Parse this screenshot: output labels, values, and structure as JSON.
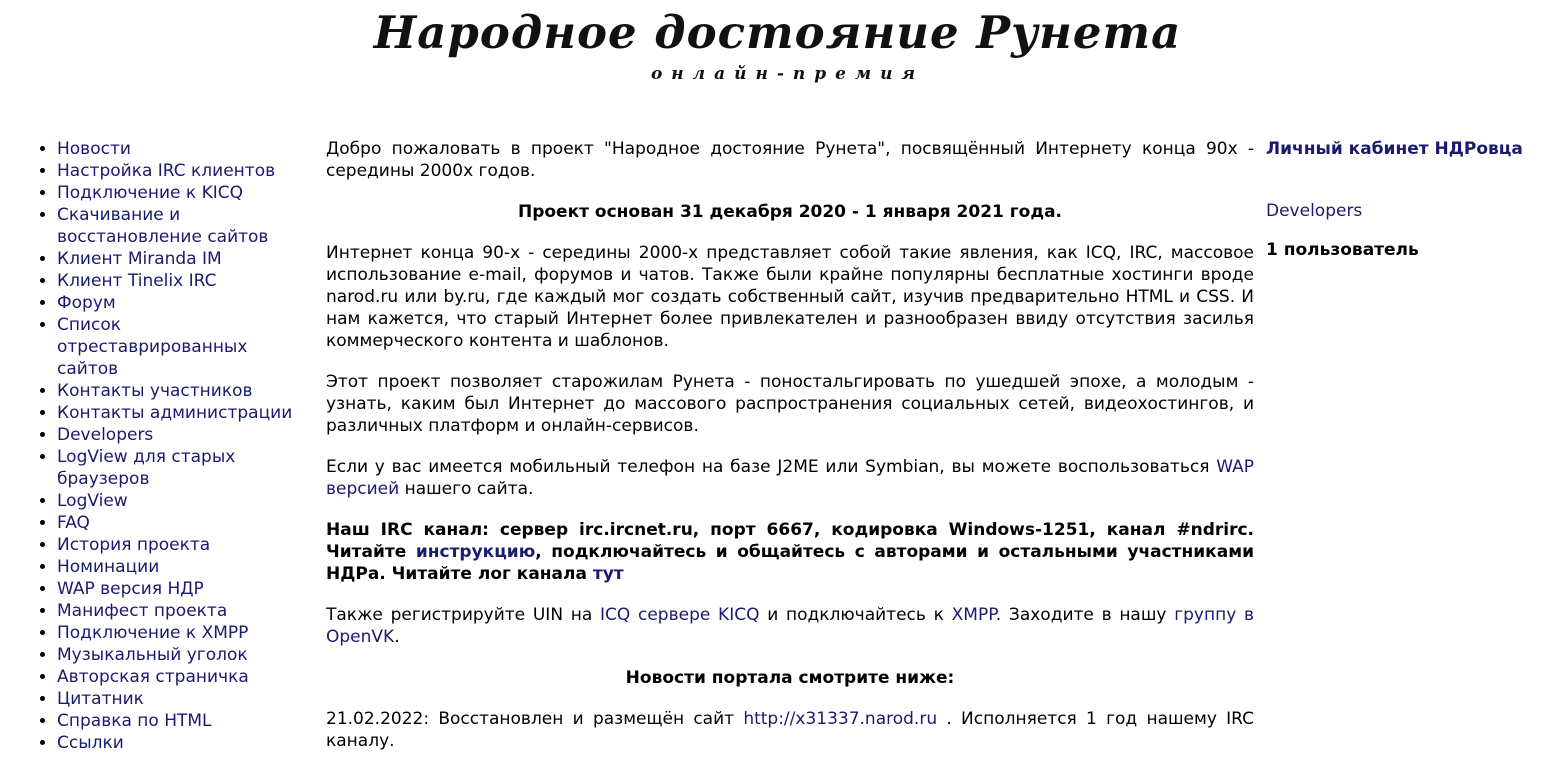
{
  "header": {
    "title": "Народное достояние Рунета",
    "subtitle": "онлайн-премия"
  },
  "sidebar": {
    "items": [
      {
        "label": "Новости"
      },
      {
        "label": "Настройка IRC клиентов"
      },
      {
        "label": "Подключение к KICQ"
      },
      {
        "label": "Скачивание и восстановление сайтов"
      },
      {
        "label": "Клиент Miranda IM"
      },
      {
        "label": "Клиент Tinelix IRC"
      },
      {
        "label": "Форум"
      },
      {
        "label": "Список отреставрированных сайтов"
      },
      {
        "label": "Контакты участников"
      },
      {
        "label": "Контакты администрации"
      },
      {
        "label": "Developers"
      },
      {
        "label": "LogView для старых браузеров"
      },
      {
        "label": "LogView"
      },
      {
        "label": "FAQ"
      },
      {
        "label": "История проекта"
      },
      {
        "label": "Номинации"
      },
      {
        "label": "WAP версия НДР"
      },
      {
        "label": "Манифест проекта"
      },
      {
        "label": "Подключение к XMPP"
      },
      {
        "label": "Музыкальный уголок"
      },
      {
        "label": "Авторская страничка"
      },
      {
        "label": "Цитатник"
      },
      {
        "label": "Справка по HTML"
      },
      {
        "label": "Ссылки"
      }
    ]
  },
  "main": {
    "welcome": "Добро пожаловать в проект \"Народное достояние Рунета\", посвящённый Интернету конца 90х - середины 2000х годов.",
    "founded": "Проект основан 31 декабря 2020 - 1 января 2021 года.",
    "about": "Интернет конца 90-х - середины 2000-х представляет собой такие явления, как ICQ, IRC, массовое использование e-mail, форумов и чатов. Также были крайне популярны бесплатные хостинги вроде narod.ru или by.ru, где каждый мог создать собственный сайт, изучив предварительно HTML и CSS. И нам кажется, что старый Интернет более привлекателен и разнообразен ввиду отсутствия засилья коммерческого контента и шаблонов.",
    "purpose": "Этот проект позволяет старожилам Рунета - поностальгировать по ушедшей эпохе, а молодым - узнать, каким был Интернет до массового распространения социальных сетей, видеохостингов, и различных платформ и онлайн-сервисов.",
    "mobile": {
      "text_before": "Если у вас имеется мобильный телефон на базе J2ME или Symbian, вы можете воспользоваться ",
      "link": "WAP версией",
      "text_after": " нашего сайта."
    },
    "irc": {
      "text_1": "Наш IRC канал: сервер irc.ircnet.ru, порт 6667, кодировка Windows-1251, канал #ndrirc. Читайте ",
      "link_1": "инструкцию",
      "text_2": ", подключайтесь и общайтесь с авторами и остальными участниками НДРа. Читайте лог канала ",
      "link_2": "тут"
    },
    "register": {
      "text_1": "Также регистрируйте UIN на ",
      "link_1": "ICQ сервере KICQ",
      "text_2": " и подключайтесь к ",
      "link_2": "XMPP",
      "text_3": ". Заходите в нашу ",
      "link_3": "группу в OpenVK",
      "text_4": "."
    },
    "news_heading": "Новости портала смотрите ниже:",
    "news": {
      "text_1": "21.02.2022: Восстановлен и размещён сайт ",
      "link": "http://x31337.narod.ru",
      "text_2": " . Исполняется 1 год нашему IRC каналу."
    }
  },
  "right": {
    "cabinet_link": "Личный кабинет НДРовца",
    "developers_link": "Developers",
    "users": "1 пользователь"
  },
  "colors": {
    "link": "#1a1a6e",
    "text": "#000000",
    "background": "#ffffff"
  }
}
